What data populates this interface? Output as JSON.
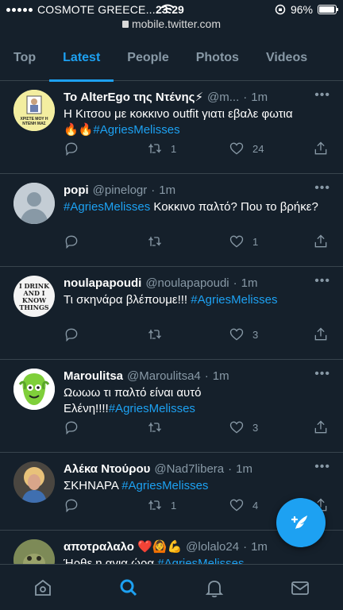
{
  "status": {
    "carrier": "COSMOTE GREECE...",
    "time": "23:29",
    "battery": "96%",
    "battery_level": 0.96,
    "url": "mobile.twitter.com"
  },
  "tabs": [
    {
      "label": "Top",
      "active": false
    },
    {
      "label": "Latest",
      "active": true
    },
    {
      "label": "People",
      "active": false
    },
    {
      "label": "Photos",
      "active": false
    },
    {
      "label": "Videos",
      "active": false
    }
  ],
  "tweets": [
    {
      "name": "Το AlterEgo της Ντένης⚡",
      "handle": "@m...",
      "time": "1m",
      "text": "Η Κιτσου με κοκκινο outfit γιατι εβαλε φωτια",
      "text2": "🔥🔥",
      "hashtag": "#AgriesMelisses",
      "replies": "",
      "retweets": "1",
      "likes": "24",
      "avatar_text": "ΧΡΙΣΤΕ ΜΟΥ Η ΝΤΕΝΗ ΜΑΣ"
    },
    {
      "name": "popi",
      "handle": "@pinelogr",
      "time": "1m",
      "hashtag": "#AgriesMelisses",
      "text": "Κοκκινο παλτό? Που το βρήκε?",
      "replies": "",
      "retweets": "",
      "likes": "1"
    },
    {
      "name": "noulapapoudi",
      "handle": "@noulapapoudi",
      "time": "1m",
      "text": "Τι σκηνάρα βλέπουμε!!!",
      "hashtag": "#AgriesMelisses",
      "replies": "",
      "retweets": "",
      "likes": "3",
      "avatar_text": "I DRINK AND I KNOW THINGS"
    },
    {
      "name": "Maroulitsa",
      "handle": "@Maroulitsa4",
      "time": "1m",
      "text": "Ωωωω τι παλτό είναι αυτό Ελένη!!!!",
      "hashtag": "#AgriesMelisses",
      "replies": "",
      "retweets": "",
      "likes": "3"
    },
    {
      "name": "Αλέκα Ντούρου",
      "handle": "@Nad7libera",
      "time": "1m",
      "text": "ΣΚΗΝΑΡΑ",
      "hashtag": "#AgriesMelisses",
      "replies": "",
      "retweets": "1",
      "likes": "4"
    },
    {
      "name": "αποτραλαλο ❤️🙆💪",
      "handle": "@lolalo24",
      "time": "1m",
      "text": "Ήρθε η αγια ώρα",
      "hashtag": "#AgriesMelisses",
      "replies": "",
      "retweets": "",
      "likes": ""
    }
  ],
  "colors": {
    "background": "#15202b",
    "accent": "#1da1f2",
    "muted": "#8899a6",
    "border": "#38444d"
  },
  "icons": {
    "nav": [
      "home-icon",
      "search-icon",
      "notifications-icon",
      "messages-icon"
    ],
    "fab": "compose-tweet-icon"
  }
}
